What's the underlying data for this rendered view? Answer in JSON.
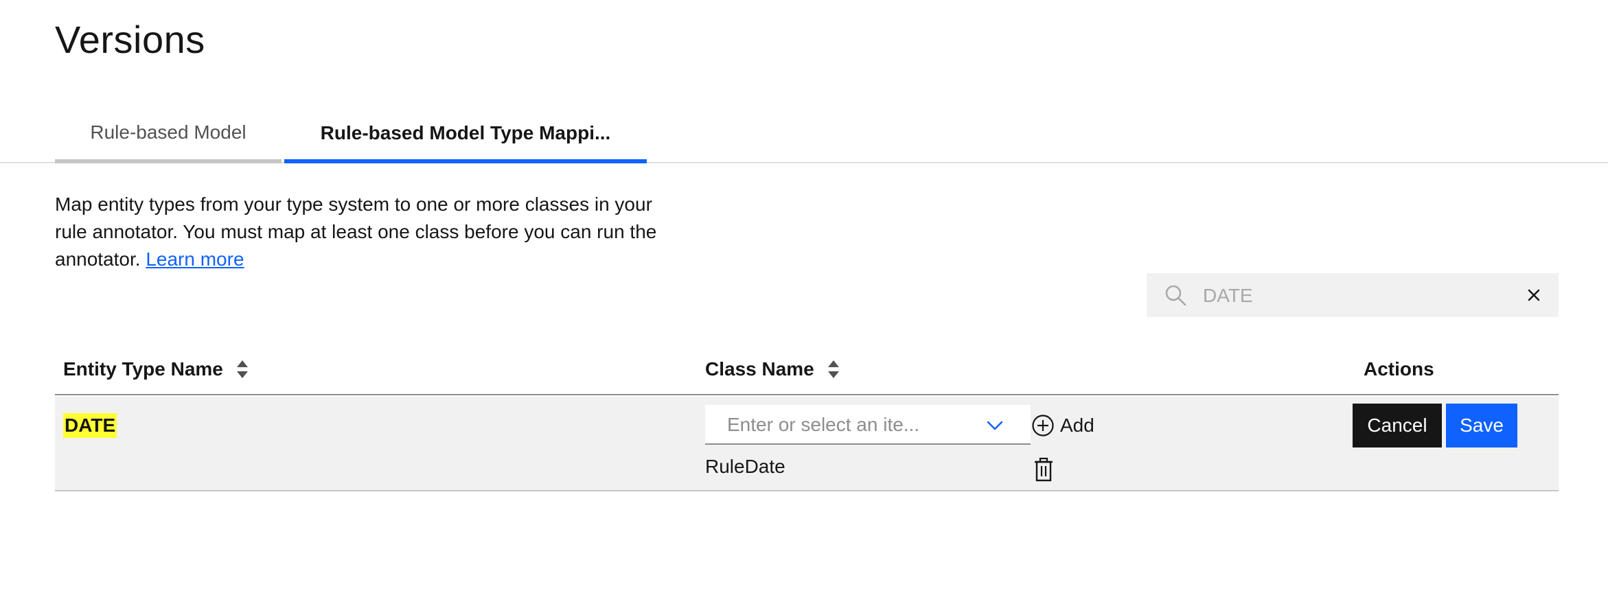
{
  "page": {
    "title": "Versions"
  },
  "tabs": [
    {
      "label": "Rule-based Model",
      "selected": false
    },
    {
      "label": "Rule-based Model Type Mappi...",
      "selected": true
    }
  ],
  "description": {
    "text": "Map entity types from your type system to one or more classes in your rule annotator. You must map at least one class before you can run the annotator. ",
    "link_label": "Learn more"
  },
  "search": {
    "value": "DATE",
    "icon": "search-icon",
    "clear_icon": "close-icon"
  },
  "table": {
    "headers": {
      "entity_type_name": "Entity Type Name",
      "class_name": "Class Name",
      "actions": "Actions"
    },
    "rows": [
      {
        "entity": "DATE",
        "class_select_placeholder": "Enter or select an ite...",
        "add_label": "Add",
        "classes": [
          "RuleDate"
        ],
        "actions": {
          "cancel": "Cancel",
          "save": "Save"
        }
      }
    ]
  },
  "colors": {
    "accent": "#0f62fe",
    "highlight": "#ffff33",
    "dark_button": "#161616",
    "row_background": "#f1f1f1"
  }
}
